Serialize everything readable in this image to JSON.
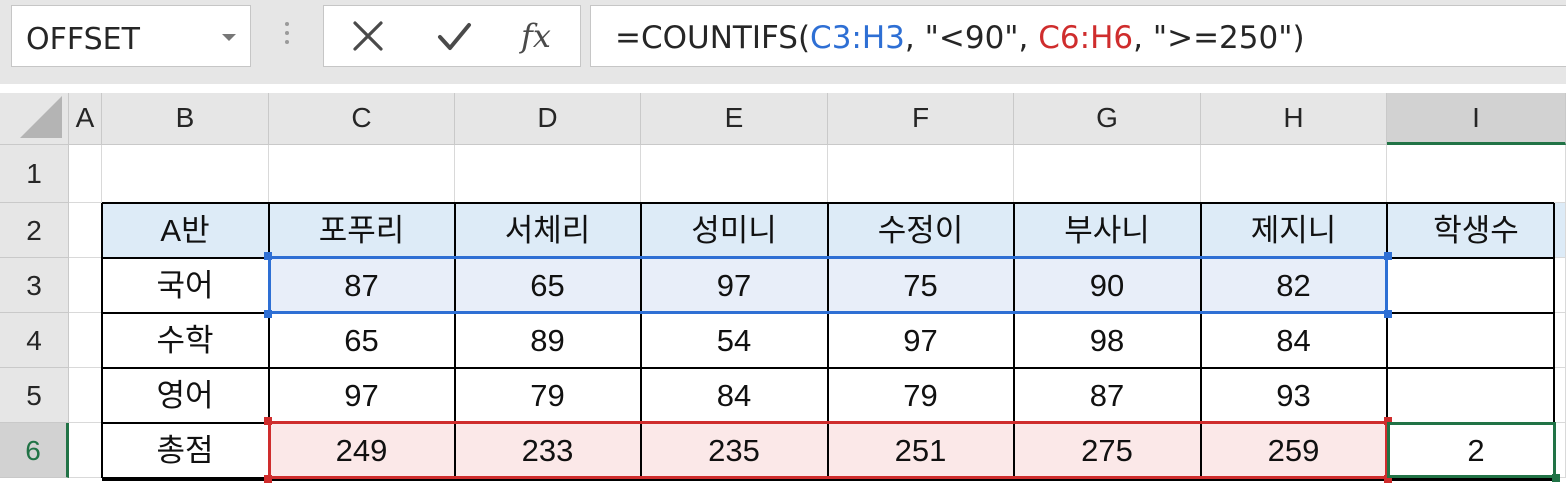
{
  "name_box": {
    "value": "OFFSET"
  },
  "formula_bar": {
    "prefix": "=COUNTIFS(",
    "ref1": "C3:H3",
    "arg1": ", \"<90\", ",
    "ref2": "C6:H6",
    "arg2": ", \">=250\")",
    "buttons": {
      "cancel_icon": "close-icon",
      "enter_icon": "check-icon",
      "function_label": "fx"
    }
  },
  "colors": {
    "ref_blue": "#2e6fd4",
    "ref_red": "#cf2d2d",
    "selection_green": "#217346",
    "header_fill": "#ddebf7"
  },
  "columns": [
    "A",
    "B",
    "C",
    "D",
    "E",
    "F",
    "G",
    "H",
    "I"
  ],
  "rows": [
    "1",
    "2",
    "3",
    "4",
    "5",
    "6"
  ],
  "table": {
    "header": [
      "A반",
      "포푸리",
      "서체리",
      "성미니",
      "수정이",
      "부사니",
      "제지니",
      "학생수"
    ],
    "rows": [
      [
        "국어",
        "87",
        "65",
        "97",
        "75",
        "90",
        "82",
        ""
      ],
      [
        "수학",
        "65",
        "89",
        "54",
        "97",
        "98",
        "84",
        ""
      ],
      [
        "영어",
        "97",
        "79",
        "84",
        "79",
        "87",
        "93",
        ""
      ],
      [
        "총점",
        "249",
        "233",
        "235",
        "251",
        "275",
        "259",
        "2"
      ]
    ]
  }
}
